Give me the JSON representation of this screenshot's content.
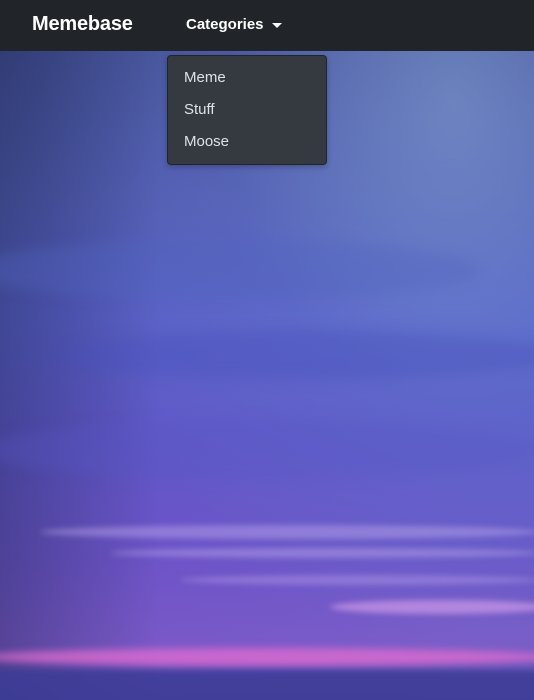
{
  "navbar": {
    "brand": "Memebase",
    "categories_label": "Categories",
    "dropdown_items": [
      {
        "label": "Meme"
      },
      {
        "label": "Stuff"
      },
      {
        "label": "Moose"
      }
    ]
  },
  "colors": {
    "navbar_bg": "#212529",
    "dropdown_bg": "#343a40",
    "text_light": "#ffffff",
    "dropdown_text": "#dee2e6"
  },
  "background": {
    "type": "sky-photo-purple-sunset"
  }
}
